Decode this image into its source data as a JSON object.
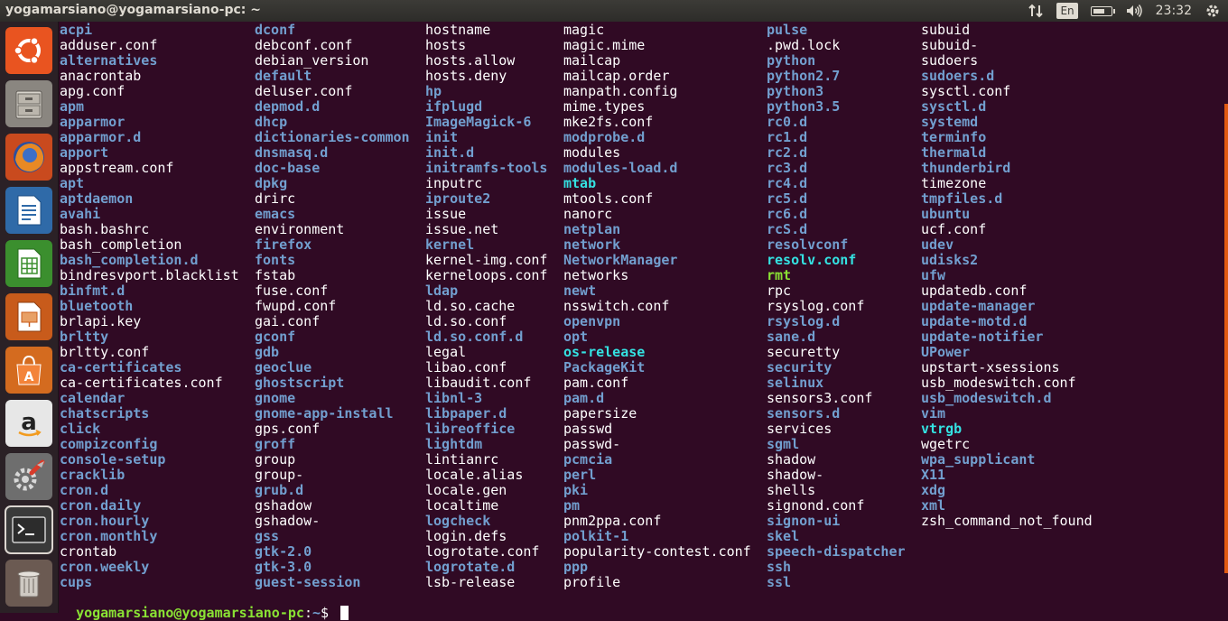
{
  "window": {
    "title": "yogamarsiano@yogamarsiano-pc: ~"
  },
  "indicators": {
    "keyboard": "En",
    "time": "23:32",
    "battery_level": 0.75
  },
  "launcher": [
    {
      "name": "ubuntu-dash-icon"
    },
    {
      "name": "files-icon"
    },
    {
      "name": "firefox-icon"
    },
    {
      "name": "libreoffice-writer-icon"
    },
    {
      "name": "libreoffice-calc-icon"
    },
    {
      "name": "libreoffice-impress-icon"
    },
    {
      "name": "software-center-icon"
    },
    {
      "name": "amazon-icon"
    },
    {
      "name": "system-settings-icon"
    },
    {
      "name": "terminal-icon"
    },
    {
      "name": "trash-icon"
    }
  ],
  "listing": {
    "columns": [
      [
        [
          "acpi",
          "d"
        ],
        [
          "adduser.conf",
          "f"
        ],
        [
          "alternatives",
          "d"
        ],
        [
          "anacrontab",
          "f"
        ],
        [
          "apg.conf",
          "f"
        ],
        [
          "apm",
          "d"
        ],
        [
          "apparmor",
          "d"
        ],
        [
          "apparmor.d",
          "d"
        ],
        [
          "apport",
          "d"
        ],
        [
          "appstream.conf",
          "f"
        ],
        [
          "apt",
          "d"
        ],
        [
          "aptdaemon",
          "d"
        ],
        [
          "avahi",
          "d"
        ],
        [
          "bash.bashrc",
          "f"
        ],
        [
          "bash_completion",
          "f"
        ],
        [
          "bash_completion.d",
          "d"
        ],
        [
          "bindresvport.blacklist",
          "f"
        ],
        [
          "binfmt.d",
          "d"
        ],
        [
          "bluetooth",
          "d"
        ],
        [
          "brlapi.key",
          "f"
        ],
        [
          "brltty",
          "d"
        ],
        [
          "brltty.conf",
          "f"
        ],
        [
          "ca-certificates",
          "d"
        ],
        [
          "ca-certificates.conf",
          "f"
        ],
        [
          "calendar",
          "d"
        ],
        [
          "chatscripts",
          "d"
        ],
        [
          "click",
          "d"
        ],
        [
          "compizconfig",
          "d"
        ],
        [
          "console-setup",
          "d"
        ],
        [
          "cracklib",
          "d"
        ],
        [
          "cron.d",
          "d"
        ],
        [
          "cron.daily",
          "d"
        ],
        [
          "cron.hourly",
          "d"
        ],
        [
          "cron.monthly",
          "d"
        ],
        [
          "crontab",
          "f"
        ],
        [
          "cron.weekly",
          "d"
        ],
        [
          "cups",
          "d"
        ]
      ],
      [
        [
          "dconf",
          "d"
        ],
        [
          "debconf.conf",
          "f"
        ],
        [
          "debian_version",
          "f"
        ],
        [
          "default",
          "d"
        ],
        [
          "deluser.conf",
          "f"
        ],
        [
          "depmod.d",
          "d"
        ],
        [
          "dhcp",
          "d"
        ],
        [
          "dictionaries-common",
          "d"
        ],
        [
          "dnsmasq.d",
          "d"
        ],
        [
          "doc-base",
          "d"
        ],
        [
          "dpkg",
          "d"
        ],
        [
          "drirc",
          "f"
        ],
        [
          "emacs",
          "d"
        ],
        [
          "environment",
          "f"
        ],
        [
          "firefox",
          "d"
        ],
        [
          "fonts",
          "d"
        ],
        [
          "fstab",
          "f"
        ],
        [
          "fuse.conf",
          "f"
        ],
        [
          "fwupd.conf",
          "f"
        ],
        [
          "gai.conf",
          "f"
        ],
        [
          "gconf",
          "d"
        ],
        [
          "gdb",
          "d"
        ],
        [
          "geoclue",
          "d"
        ],
        [
          "ghostscript",
          "d"
        ],
        [
          "gnome",
          "d"
        ],
        [
          "gnome-app-install",
          "d"
        ],
        [
          "gps.conf",
          "f"
        ],
        [
          "groff",
          "d"
        ],
        [
          "group",
          "f"
        ],
        [
          "group-",
          "f"
        ],
        [
          "grub.d",
          "d"
        ],
        [
          "gshadow",
          "f"
        ],
        [
          "gshadow-",
          "f"
        ],
        [
          "gss",
          "d"
        ],
        [
          "gtk-2.0",
          "d"
        ],
        [
          "gtk-3.0",
          "d"
        ],
        [
          "guest-session",
          "d"
        ]
      ],
      [
        [
          "hostname",
          "f"
        ],
        [
          "hosts",
          "f"
        ],
        [
          "hosts.allow",
          "f"
        ],
        [
          "hosts.deny",
          "f"
        ],
        [
          "hp",
          "d"
        ],
        [
          "ifplugd",
          "d"
        ],
        [
          "ImageMagick-6",
          "d"
        ],
        [
          "init",
          "d"
        ],
        [
          "init.d",
          "d"
        ],
        [
          "initramfs-tools",
          "d"
        ],
        [
          "inputrc",
          "f"
        ],
        [
          "iproute2",
          "d"
        ],
        [
          "issue",
          "f"
        ],
        [
          "issue.net",
          "f"
        ],
        [
          "kernel",
          "d"
        ],
        [
          "kernel-img.conf",
          "f"
        ],
        [
          "kerneloops.conf",
          "f"
        ],
        [
          "ldap",
          "d"
        ],
        [
          "ld.so.cache",
          "f"
        ],
        [
          "ld.so.conf",
          "f"
        ],
        [
          "ld.so.conf.d",
          "d"
        ],
        [
          "legal",
          "f"
        ],
        [
          "libao.conf",
          "f"
        ],
        [
          "libaudit.conf",
          "f"
        ],
        [
          "libnl-3",
          "d"
        ],
        [
          "libpaper.d",
          "d"
        ],
        [
          "libreoffice",
          "d"
        ],
        [
          "lightdm",
          "d"
        ],
        [
          "lintianrc",
          "f"
        ],
        [
          "locale.alias",
          "f"
        ],
        [
          "locale.gen",
          "f"
        ],
        [
          "localtime",
          "f"
        ],
        [
          "logcheck",
          "d"
        ],
        [
          "login.defs",
          "f"
        ],
        [
          "logrotate.conf",
          "f"
        ],
        [
          "logrotate.d",
          "d"
        ],
        [
          "lsb-release",
          "f"
        ]
      ],
      [
        [
          "magic",
          "f"
        ],
        [
          "magic.mime",
          "f"
        ],
        [
          "mailcap",
          "f"
        ],
        [
          "mailcap.order",
          "f"
        ],
        [
          "manpath.config",
          "f"
        ],
        [
          "mime.types",
          "f"
        ],
        [
          "mke2fs.conf",
          "f"
        ],
        [
          "modprobe.d",
          "d"
        ],
        [
          "modules",
          "f"
        ],
        [
          "modules-load.d",
          "d"
        ],
        [
          "mtab",
          "l"
        ],
        [
          "mtools.conf",
          "f"
        ],
        [
          "nanorc",
          "f"
        ],
        [
          "netplan",
          "d"
        ],
        [
          "network",
          "d"
        ],
        [
          "NetworkManager",
          "d"
        ],
        [
          "networks",
          "f"
        ],
        [
          "newt",
          "d"
        ],
        [
          "nsswitch.conf",
          "f"
        ],
        [
          "openvpn",
          "d"
        ],
        [
          "opt",
          "d"
        ],
        [
          "os-release",
          "l"
        ],
        [
          "PackageKit",
          "d"
        ],
        [
          "pam.conf",
          "f"
        ],
        [
          "pam.d",
          "d"
        ],
        [
          "papersize",
          "f"
        ],
        [
          "passwd",
          "f"
        ],
        [
          "passwd-",
          "f"
        ],
        [
          "pcmcia",
          "d"
        ],
        [
          "perl",
          "d"
        ],
        [
          "pki",
          "d"
        ],
        [
          "pm",
          "d"
        ],
        [
          "pnm2ppa.conf",
          "f"
        ],
        [
          "polkit-1",
          "d"
        ],
        [
          "popularity-contest.conf",
          "f"
        ],
        [
          "ppp",
          "d"
        ],
        [
          "profile",
          "f"
        ]
      ],
      [
        [
          "pulse",
          "d"
        ],
        [
          ".pwd.lock",
          "f"
        ],
        [
          "python",
          "d"
        ],
        [
          "python2.7",
          "d"
        ],
        [
          "python3",
          "d"
        ],
        [
          "python3.5",
          "d"
        ],
        [
          "rc0.d",
          "d"
        ],
        [
          "rc1.d",
          "d"
        ],
        [
          "rc2.d",
          "d"
        ],
        [
          "rc3.d",
          "d"
        ],
        [
          "rc4.d",
          "d"
        ],
        [
          "rc5.d",
          "d"
        ],
        [
          "rc6.d",
          "d"
        ],
        [
          "rcS.d",
          "d"
        ],
        [
          "resolvconf",
          "d"
        ],
        [
          "resolv.conf",
          "l"
        ],
        [
          "rmt",
          "x"
        ],
        [
          "rpc",
          "f"
        ],
        [
          "rsyslog.conf",
          "f"
        ],
        [
          "rsyslog.d",
          "d"
        ],
        [
          "sane.d",
          "d"
        ],
        [
          "securetty",
          "f"
        ],
        [
          "security",
          "d"
        ],
        [
          "selinux",
          "d"
        ],
        [
          "sensors3.conf",
          "f"
        ],
        [
          "sensors.d",
          "d"
        ],
        [
          "services",
          "f"
        ],
        [
          "sgml",
          "d"
        ],
        [
          "shadow",
          "f"
        ],
        [
          "shadow-",
          "f"
        ],
        [
          "shells",
          "f"
        ],
        [
          "signond.conf",
          "f"
        ],
        [
          "signon-ui",
          "d"
        ],
        [
          "skel",
          "d"
        ],
        [
          "speech-dispatcher",
          "d"
        ],
        [
          "ssh",
          "d"
        ],
        [
          "ssl",
          "d"
        ]
      ],
      [
        [
          "subuid",
          "f"
        ],
        [
          "subuid-",
          "f"
        ],
        [
          "sudoers",
          "f"
        ],
        [
          "sudoers.d",
          "d"
        ],
        [
          "sysctl.conf",
          "f"
        ],
        [
          "sysctl.d",
          "d"
        ],
        [
          "systemd",
          "d"
        ],
        [
          "terminfo",
          "d"
        ],
        [
          "thermald",
          "d"
        ],
        [
          "thunderbird",
          "d"
        ],
        [
          "timezone",
          "f"
        ],
        [
          "tmpfiles.d",
          "d"
        ],
        [
          "ubuntu",
          "d"
        ],
        [
          "ucf.conf",
          "f"
        ],
        [
          "udev",
          "d"
        ],
        [
          "udisks2",
          "d"
        ],
        [
          "ufw",
          "d"
        ],
        [
          "updatedb.conf",
          "f"
        ],
        [
          "update-manager",
          "d"
        ],
        [
          "update-motd.d",
          "d"
        ],
        [
          "update-notifier",
          "d"
        ],
        [
          "UPower",
          "d"
        ],
        [
          "upstart-xsessions",
          "f"
        ],
        [
          "usb_modeswitch.conf",
          "f"
        ],
        [
          "usb_modeswitch.d",
          "d"
        ],
        [
          "vim",
          "d"
        ],
        [
          "vtrgb",
          "l"
        ],
        [
          "wgetrc",
          "f"
        ],
        [
          "wpa_supplicant",
          "d"
        ],
        [
          "X11",
          "d"
        ],
        [
          "xdg",
          "d"
        ],
        [
          "xml",
          "d"
        ],
        [
          "zsh_command_not_found",
          "f"
        ]
      ]
    ]
  },
  "prompt": {
    "user_host": "yogamarsiano@yogamarsiano-pc",
    "sep": ":",
    "path": "~",
    "symbol": "$ "
  },
  "colors": {
    "background": "#300a24",
    "directory": "#729fcf",
    "symlink": "#34e2e2",
    "executable": "#8ae234",
    "file": "#ffffff"
  }
}
